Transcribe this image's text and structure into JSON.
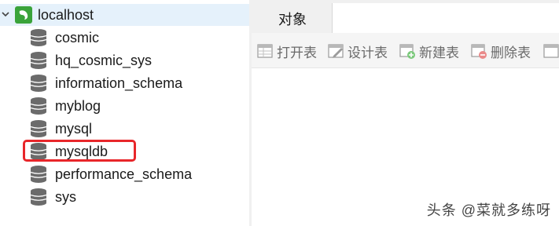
{
  "connection": {
    "name": "localhost",
    "icon": "dolphin-connection-icon"
  },
  "databases": [
    {
      "name": "cosmic",
      "icon": "database-icon"
    },
    {
      "name": "hq_cosmic_sys",
      "icon": "database-icon"
    },
    {
      "name": "information_schema",
      "icon": "database-icon"
    },
    {
      "name": "myblog",
      "icon": "database-icon"
    },
    {
      "name": "mysql",
      "icon": "database-icon"
    },
    {
      "name": "mysqldb",
      "icon": "database-icon",
      "highlighted": true
    },
    {
      "name": "performance_schema",
      "icon": "database-icon"
    },
    {
      "name": "sys",
      "icon": "database-icon"
    }
  ],
  "highlight_color": "#e8262a",
  "tabs": [
    {
      "label": "对象"
    }
  ],
  "toolbar": {
    "open_table": "打开表",
    "design_table": "设计表",
    "new_table": "新建表",
    "delete_table": "删除表"
  },
  "watermark": "头条 @菜就多练呀"
}
